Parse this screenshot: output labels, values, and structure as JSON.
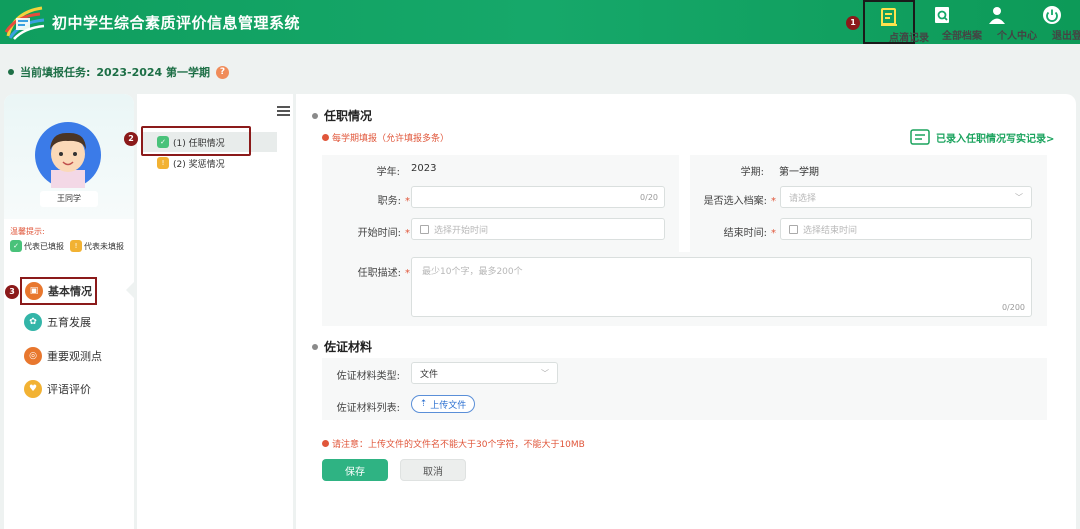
{
  "header": {
    "app_title": "初中学生综合素质评价信息管理系统",
    "nav": [
      {
        "label": "点滴记录",
        "icon": "notebook-icon",
        "active": true,
        "step": "1"
      },
      {
        "label": "全部档案",
        "icon": "archive-search-icon",
        "active": false
      },
      {
        "label": "个人中心",
        "icon": "user-icon",
        "active": false
      },
      {
        "label": "退出登录",
        "icon": "power-icon",
        "active": false
      }
    ]
  },
  "task": {
    "label": "当前填报任务:",
    "value": "2023-2024 第一学期",
    "help": "?"
  },
  "profile": {
    "name": "王同学",
    "legend_title": "温馨提示:",
    "legend_filled": "代表已填报",
    "legend_unfilled": "代表未填报",
    "filled_glyph": "✓",
    "unfilled_glyph": "!"
  },
  "sidebar": {
    "step": "3",
    "items": [
      {
        "label": "基本情况",
        "icon": "basic-info-icon",
        "glyph": "▣",
        "color": "#e8772e"
      },
      {
        "label": "五育发展",
        "icon": "development-icon",
        "glyph": "✿",
        "color": "#33b5a8"
      },
      {
        "label": "重要观测点",
        "icon": "observation-icon",
        "glyph": "◎",
        "color": "#e8772e"
      },
      {
        "label": "评语评价",
        "icon": "comment-icon",
        "glyph": "♥",
        "color": "#f2b233"
      }
    ]
  },
  "tree": {
    "step": "2",
    "items": [
      {
        "label": "(1) 任职情况",
        "status_glyph": "✓",
        "status_color": "#49c27a"
      },
      {
        "label": "(2) 奖惩情况",
        "status_glyph": "!",
        "status_color": "#f2b233"
      }
    ]
  },
  "form": {
    "section1_title": "任职情况",
    "section1_note": "每学期填报（允许填报多条）",
    "history_link": "已录入任职情况写实记录>",
    "year_label": "学年:",
    "year_value": "2023",
    "term_label": "学期:",
    "term_value": "第一学期",
    "position_label": "职务:",
    "position_counter": "0/20",
    "archive_label": "是否选入档案:",
    "archive_placeholder": "请选择",
    "start_label": "开始时间:",
    "start_placeholder": "选择开始时间",
    "end_label": "结束时间:",
    "end_placeholder": "选择结束时间",
    "desc_label": "任职描述:",
    "desc_placeholder": "最少10个字，最多200个",
    "desc_counter": "0/200",
    "required_mark": "*",
    "section2_title": "佐证材料",
    "material_type_label": "佐证材料类型:",
    "material_type_value": "文件",
    "material_list_label": "佐证材料列表:",
    "upload_label": "上传文件",
    "upload_note": "请注意：上传文件的文件名不能大于30个字符，不能大于10MB",
    "save_label": "保存",
    "cancel_label": "取消"
  }
}
